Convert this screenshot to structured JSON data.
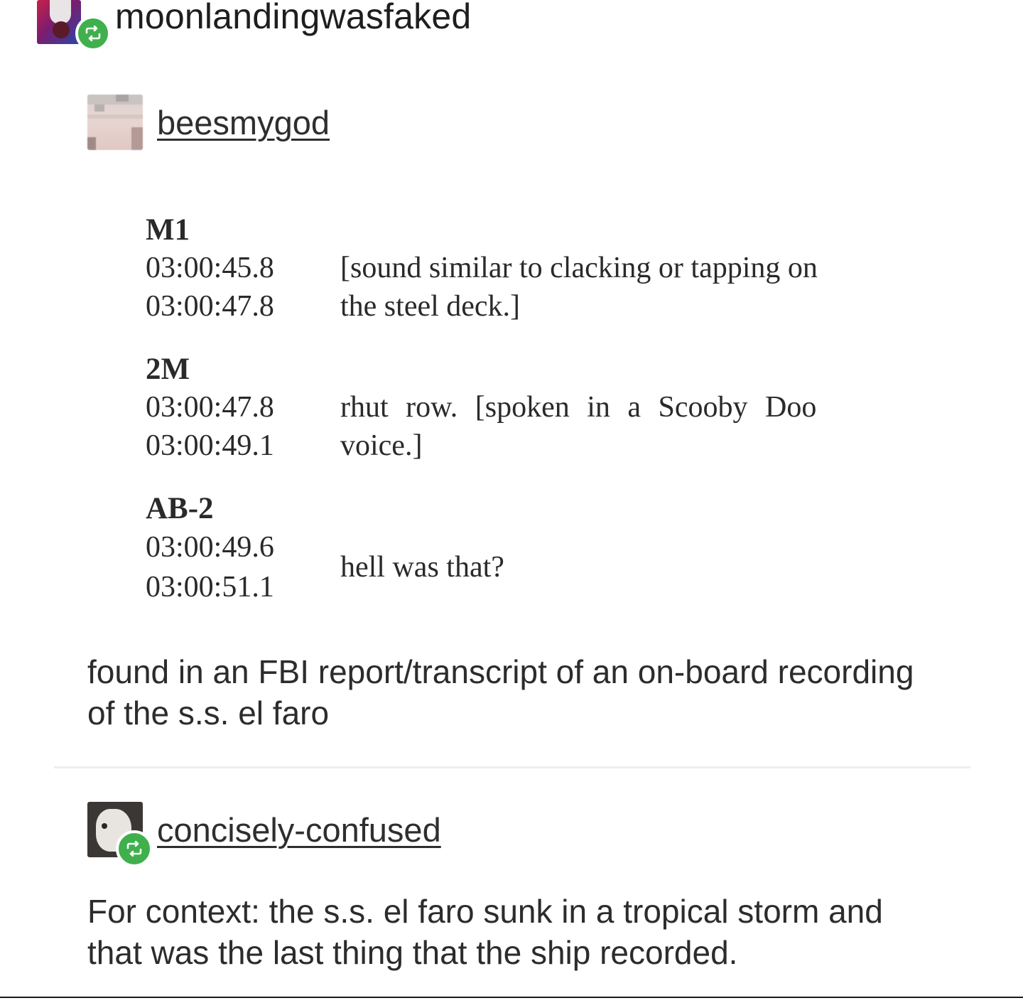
{
  "reblogger": {
    "username": "moonlandingwasfaked",
    "avatar_icon": "user-avatar",
    "badge_icon": "reblog-icon",
    "badge_color": "#3fb04c"
  },
  "trail": [
    {
      "username": "beesmygod",
      "avatar_icon": "user-avatar",
      "transcript": [
        {
          "speaker": "M1",
          "lines": [
            {
              "time": "03:00:45.8",
              "text": "[sound similar to clacking or tapping on"
            },
            {
              "time": "03:00:47.8",
              "text": "the steel deck.]"
            }
          ]
        },
        {
          "speaker": "2M",
          "lines": [
            {
              "time": "03:00:47.8",
              "text": "rhut row. [spoken in a Scooby Doo"
            },
            {
              "time": "03:00:49.1",
              "text": "voice.]"
            }
          ]
        },
        {
          "speaker": "AB-2",
          "times": [
            "03:00:49.6",
            "03:00:51.1"
          ],
          "text": "hell was that?"
        }
      ],
      "comment": "found in an FBI report/transcript of an on-board recording of the s.s. el faro"
    },
    {
      "username": "concisely-confused",
      "avatar_icon": "user-avatar",
      "badge_icon": "reblog-icon",
      "comment": "For context: the s.s. el faro sunk in a tropical storm and that was the last thing that the ship recorded."
    }
  ]
}
